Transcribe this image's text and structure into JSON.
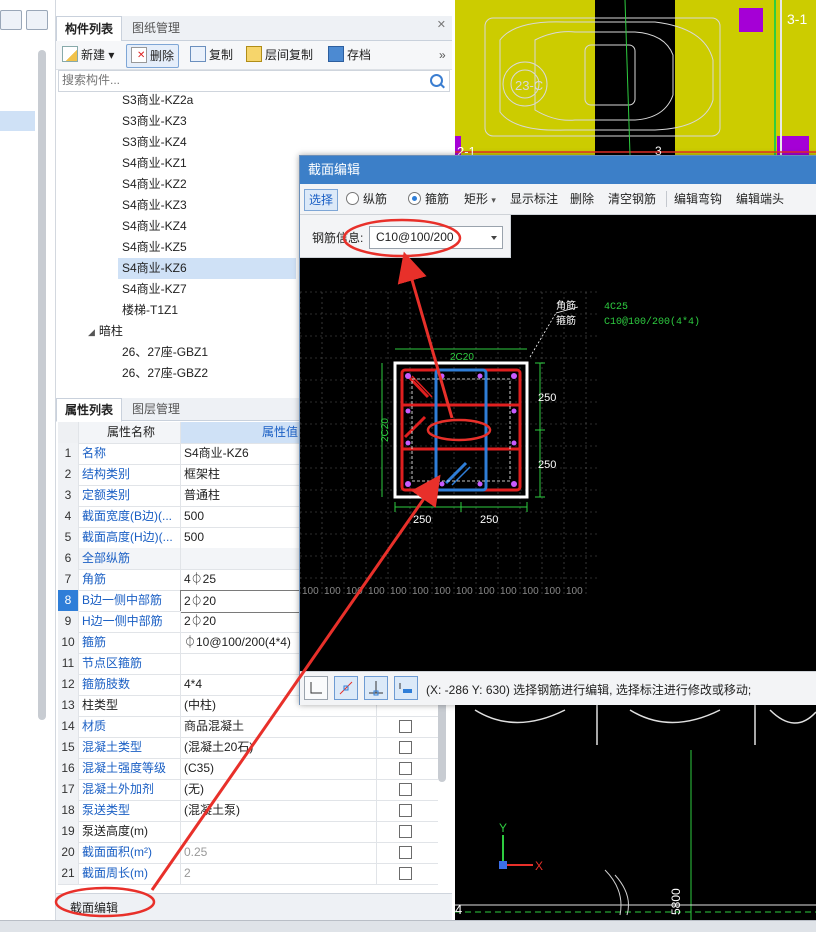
{
  "component_panel": {
    "tabs": [
      "构件列表",
      "图纸管理"
    ],
    "toolbar": {
      "new": "新建",
      "delete": "删除",
      "copy": "复制",
      "floor_copy": "层间复制",
      "save": "存档"
    },
    "search_placeholder": "搜索构件...",
    "tree": [
      {
        "label": "S3商业-KZ2a"
      },
      {
        "label": "S3商业-KZ3"
      },
      {
        "label": "S3商业-KZ4"
      },
      {
        "label": "S4商业-KZ1"
      },
      {
        "label": "S4商业-KZ2"
      },
      {
        "label": "S4商业-KZ3"
      },
      {
        "label": "S4商业-KZ4"
      },
      {
        "label": "S4商业-KZ5"
      },
      {
        "label": "S4商业-KZ6"
      },
      {
        "label": "S4商业-KZ7"
      },
      {
        "label": "楼梯-T1Z1"
      },
      {
        "label": "暗柱"
      },
      {
        "label": "26、27座-GBZ1"
      },
      {
        "label": "26、27座-GBZ2"
      }
    ]
  },
  "property_panel": {
    "tabs": [
      "属性列表",
      "图层管理"
    ],
    "header_name": "属性名称",
    "header_value": "属性值",
    "rows": [
      {
        "n": "1",
        "name": "名称",
        "value": "S4商业-KZ6"
      },
      {
        "n": "2",
        "name": "结构类别",
        "value": "框架柱"
      },
      {
        "n": "3",
        "name": "定额类别",
        "value": "普通柱"
      },
      {
        "n": "4",
        "name": "截面宽度(B边)(...",
        "value": "500"
      },
      {
        "n": "5",
        "name": "截面高度(H边)(...",
        "value": "500"
      },
      {
        "n": "6",
        "name": "全部纵筋",
        "value": ""
      },
      {
        "n": "7",
        "name": "角筋",
        "value": "4⏀25"
      },
      {
        "n": "8",
        "name": "B边一侧中部筋",
        "value": "2⏀20"
      },
      {
        "n": "9",
        "name": "H边一侧中部筋",
        "value": "2⏀20"
      },
      {
        "n": "10",
        "name": "箍筋",
        "value": "⏀10@100/200(4*4)"
      },
      {
        "n": "11",
        "name": "节点区箍筋",
        "value": ""
      },
      {
        "n": "12",
        "name": "箍筋肢数",
        "value": "4*4"
      },
      {
        "n": "13",
        "name": "柱类型",
        "value": "(中柱)"
      },
      {
        "n": "14",
        "name": "材质",
        "value": "商品混凝土"
      },
      {
        "n": "15",
        "name": "混凝土类型",
        "value": "(混凝土20石)"
      },
      {
        "n": "16",
        "name": "混凝土强度等级",
        "value": "(C35)"
      },
      {
        "n": "17",
        "name": "混凝土外加剂",
        "value": "(无)"
      },
      {
        "n": "18",
        "name": "泵送类型",
        "value": "(混凝土泵)"
      },
      {
        "n": "19",
        "name": "泵送高度(m)",
        "value": ""
      },
      {
        "n": "20",
        "name": "截面面积(m²)",
        "value": "0.25"
      },
      {
        "n": "21",
        "name": "截面周长(m)",
        "value": "2"
      }
    ]
  },
  "bottom_tab": "截面编辑",
  "dialog": {
    "title": "截面编辑",
    "toolbar": {
      "select": "选择",
      "longitudinal": "纵筋",
      "stirrup": "箍筋",
      "shape": "矩形",
      "show_annotation": "显示标注",
      "delete": "删除",
      "clear": "清空钢筋",
      "edit_hook": "编辑弯钩",
      "edit_end": "编辑端头"
    },
    "rebar_info_label": "钢筋信息:",
    "rebar_info_value": "C10@100/200",
    "drawing": {
      "legend_corner": "角筋",
      "legend_stirrup": "箍筋",
      "corner_spec": "4C25",
      "stirrup_spec": "C10@100/200(4*4)",
      "top_label": "2C20",
      "left_label": "2C20",
      "dim_250": "250",
      "grid_label": "100"
    },
    "status_text": "(X: -286 Y: 630) 选择钢筋进行编辑, 选择标注进行修改或移动;"
  },
  "cad": {
    "labels": {
      "top_right": "3-1",
      "axis_23": "23-C",
      "axis_3": "3",
      "axis_num_small": "2-1",
      "y_axis": "Y",
      "x_axis": "X",
      "bottom_4": "4",
      "bottom_dim": "5800"
    }
  },
  "colors": {
    "accent_blue": "#3c7fc8",
    "link_blue": "#1a5fc4",
    "selection": "#cfe1f6",
    "annotation_red": "#e8302a",
    "cad_yellow": "#cccc00",
    "cad_magenta": "#a500d6"
  }
}
